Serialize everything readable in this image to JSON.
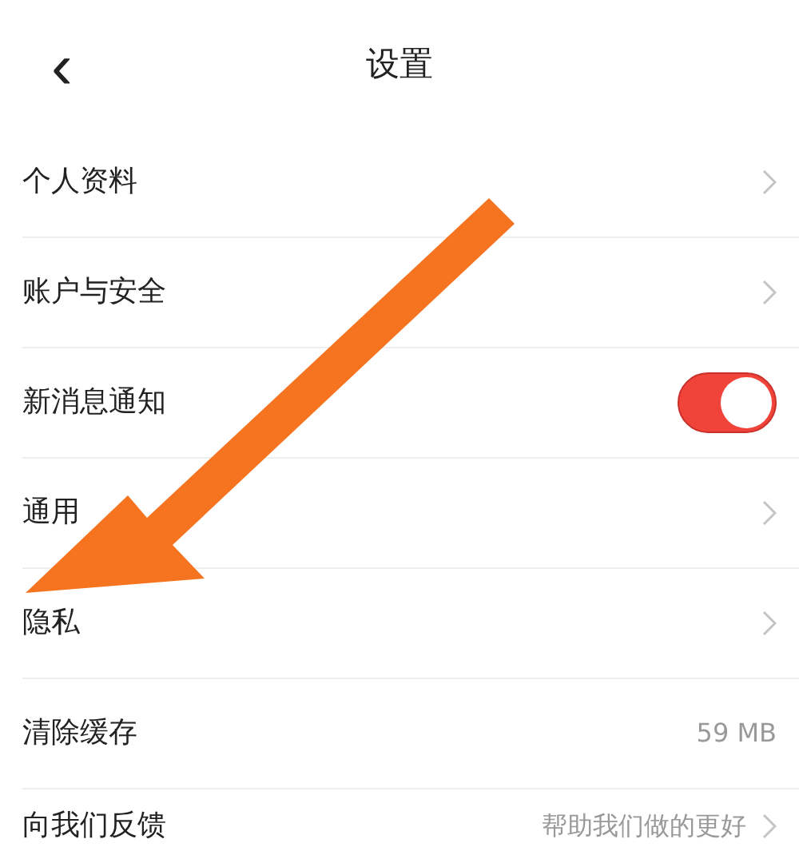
{
  "header": {
    "back": "‹",
    "title": "设置"
  },
  "items": [
    {
      "kind": "link",
      "label": "个人资料"
    },
    {
      "kind": "link",
      "label": "账户与安全"
    },
    {
      "kind": "toggle",
      "label": "新消息通知",
      "on": true
    },
    {
      "kind": "link",
      "label": "通用"
    },
    {
      "kind": "link",
      "label": "隐私"
    },
    {
      "kind": "value",
      "label": "清除缓存",
      "value": "59 MB"
    },
    {
      "kind": "link",
      "label": "向我们反馈",
      "value": "帮助我们做的更好"
    }
  ]
}
